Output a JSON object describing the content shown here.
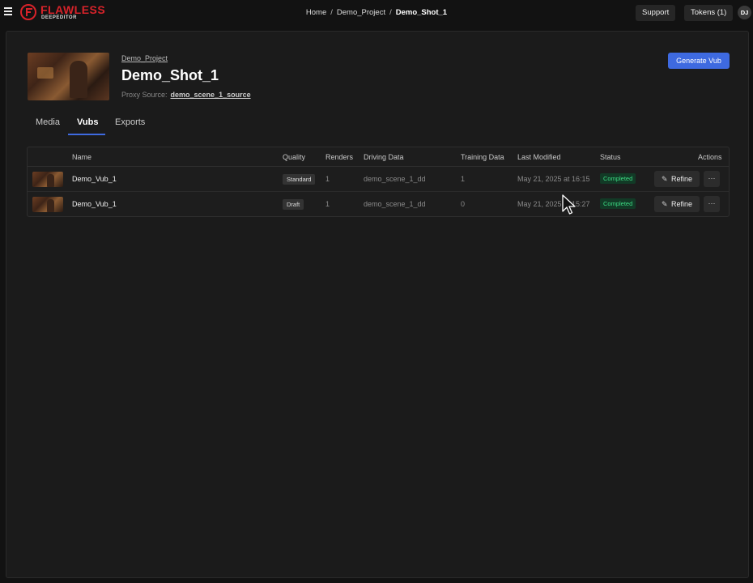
{
  "app": {
    "logo_text": "FLAWLESS",
    "logo_subtext": "DEEPEDITOR"
  },
  "breadcrumb": [
    "Home",
    "Demo_Project",
    "Demo_Shot_1"
  ],
  "header_actions": {
    "support_label": "Support",
    "tokens_label": "Tokens (1)",
    "avatar_initials": "DJ"
  },
  "shot": {
    "project_link": "Demo_Project",
    "title": "Demo_Shot_1",
    "proxy_label": "Proxy Source:",
    "proxy_value": "demo_scene_1_source",
    "generate_label": "Generate Vub"
  },
  "tabs": [
    {
      "label": "Media",
      "active": false
    },
    {
      "label": "Vubs",
      "active": true
    },
    {
      "label": "Exports",
      "active": false
    }
  ],
  "table": {
    "columns": [
      "Name",
      "Quality",
      "Renders",
      "Driving Data",
      "Training Data",
      "Last Modified",
      "Status",
      "Actions"
    ],
    "rows": [
      {
        "name": "Demo_Vub_1",
        "quality": "Standard",
        "renders": "1",
        "driving_data": "demo_scene_1_dd",
        "training_data": "1",
        "last_modified": "May 21, 2025 at 16:15",
        "status": "Completed",
        "action": "Refine",
        "more": "···"
      },
      {
        "name": "Demo_Vub_1",
        "quality": "Draft",
        "renders": "1",
        "driving_data": "demo_scene_1_dd",
        "training_data": "0",
        "last_modified": "May 21, 2025 at 15:27",
        "status": "Completed",
        "action": "Refine",
        "more": "···"
      }
    ]
  },
  "colors": {
    "accent": "#3e6ae0",
    "brand": "#d8232a",
    "status_completed": "#3ddc84",
    "background": "#121212"
  },
  "icons": [
    "menu-icon",
    "flawless-logo",
    "pencil-icon",
    "more-icon",
    "mouse-cursor"
  ]
}
